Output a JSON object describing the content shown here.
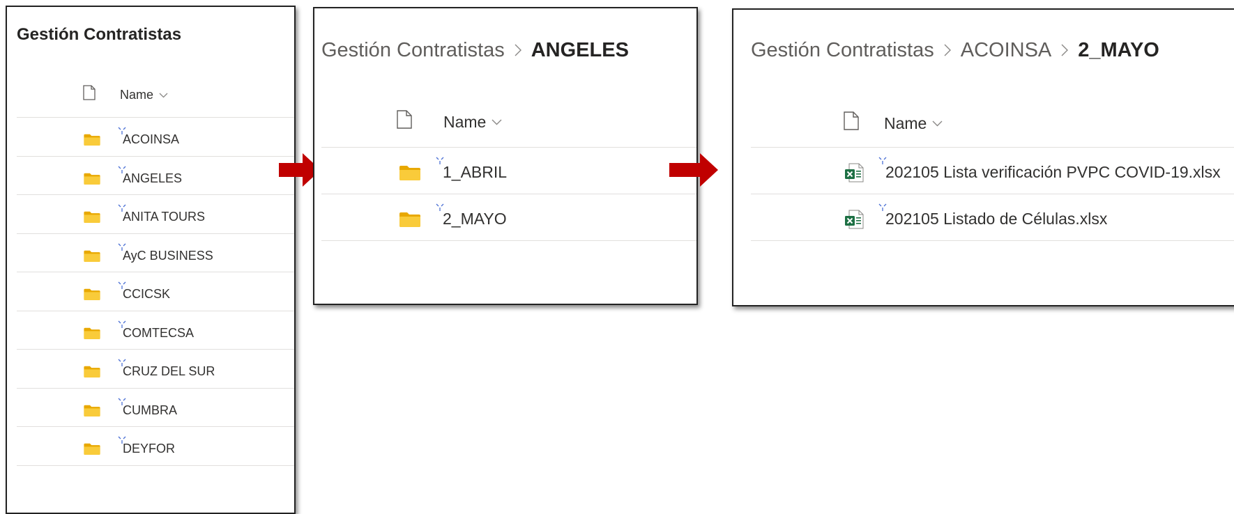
{
  "panel1": {
    "title": "Gestión Contratistas",
    "column_header": "Name",
    "items": [
      {
        "label": "ACOINSA"
      },
      {
        "label": "ANGELES"
      },
      {
        "label": "ANITA TOURS"
      },
      {
        "label": "AyC BUSINESS"
      },
      {
        "label": "CCICSK"
      },
      {
        "label": "COMTECSA"
      },
      {
        "label": "CRUZ DEL SUR"
      },
      {
        "label": "CUMBRA"
      },
      {
        "label": "DEYFOR"
      }
    ]
  },
  "panel2": {
    "breadcrumb": [
      "Gestión Contratistas",
      "ANGELES"
    ],
    "column_header": "Name",
    "items": [
      {
        "label": "1_ABRIL"
      },
      {
        "label": "2_MAYO"
      }
    ]
  },
  "panel3": {
    "breadcrumb": [
      "Gestión Contratistas",
      "ACOINSA",
      "2_MAYO"
    ],
    "column_header": "Name",
    "items": [
      {
        "label": "202105 Lista verificación PVPC COVID-19.xlsx"
      },
      {
        "label": "202105 Listado de Células.xlsx"
      }
    ]
  },
  "icons": {
    "folder": "folder-icon",
    "excel": "excel-file-icon",
    "document": "document-icon",
    "new_item": "new-item-sparkle-icon",
    "chevron": "chevron-down-icon",
    "separator": "chevron-right-icon",
    "arrow": "red-arrow-right"
  },
  "colors": {
    "folder": "#f5c518",
    "excel": "#1d7044",
    "arrow": "#c00000",
    "new_item": "#4a6fd4"
  }
}
